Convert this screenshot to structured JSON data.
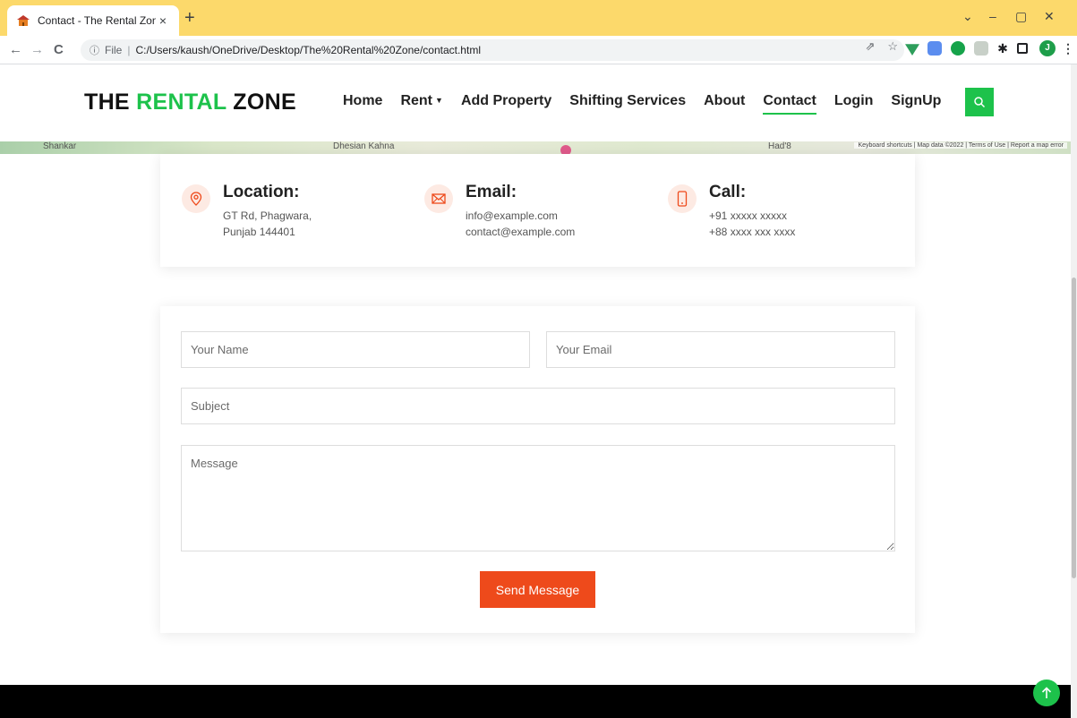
{
  "browser": {
    "tab_title": "Contact - The Rental Zone",
    "tab_close": "×",
    "new_tab": "+",
    "omnibox_info": "ⓘ",
    "omnibox_prefix": "File",
    "omnibox_sep": "|",
    "url": "C:/Users/kaush/OneDrive/Desktop/The%20Rental%20Zone/contact.html",
    "profile_initial": "J",
    "window_controls": [
      "⌄",
      "–",
      "▢",
      "✕"
    ],
    "nav_back": "←",
    "nav_forward": "→",
    "nav_reload": "C",
    "kebab": "⋮"
  },
  "site": {
    "logo_part1": "THE ",
    "logo_part2": "RENTAL",
    "logo_part3": " ZONE",
    "nav": [
      {
        "label": "Home"
      },
      {
        "label": "Rent"
      },
      {
        "label": "Add Property"
      },
      {
        "label": "Shifting Services"
      },
      {
        "label": "About"
      },
      {
        "label": "Contact"
      },
      {
        "label": "Login"
      },
      {
        "label": "SignUp"
      }
    ],
    "rent_caret": "▼"
  },
  "map": {
    "labels": [
      "Shankar",
      "Dhesian Kahna",
      "Had'8"
    ],
    "attribution": "Keyboard shortcuts | Map data ©2022 | Terms of Use | Report a map error"
  },
  "contact_info": {
    "location": {
      "title": "Location:",
      "line1": "GT Rd, Phagwara,",
      "line2": "Punjab 144401"
    },
    "email": {
      "title": "Email:",
      "line1": "info@example.com",
      "line2": "contact@example.com"
    },
    "call": {
      "title": "Call:",
      "line1": "+91 xxxxx xxxxx",
      "line2": "+88 xxxx xxx xxxx"
    }
  },
  "form": {
    "name_placeholder": "Your Name",
    "email_placeholder": "Your Email",
    "subject_placeholder": "Subject",
    "message_placeholder": "Message",
    "submit_label": "Send Message"
  },
  "colors": {
    "brand_green": "#1dc24b",
    "accent_orange": "#ee4a1b",
    "tabbar_yellow": "#fcd96b"
  }
}
